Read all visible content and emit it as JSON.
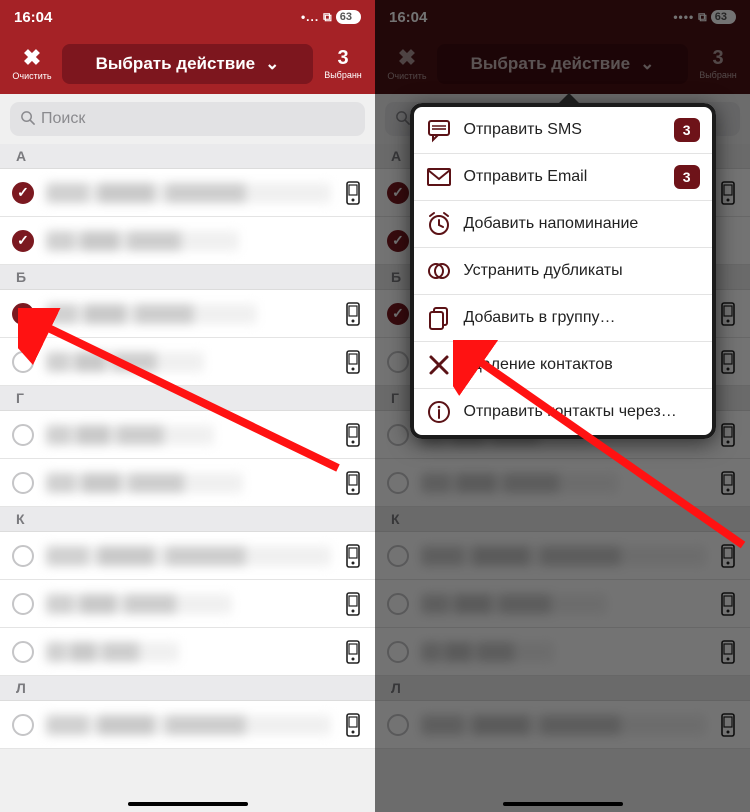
{
  "status": {
    "time": "16:04",
    "battery": "63"
  },
  "toolbar": {
    "clear_label": "Очистить",
    "action_label": "Выбрать действие",
    "selected_count": "3",
    "selected_label": "Выбранн"
  },
  "search": {
    "placeholder": "Поиск"
  },
  "sections": {
    "0": {
      "letter": "А"
    },
    "1": {
      "letter": "Б"
    },
    "2": {
      "letter": "Г"
    },
    "3": {
      "letter": "К"
    },
    "4": {
      "letter": "Л"
    }
  },
  "menu": {
    "items": {
      "0": {
        "label": "Отправить SMS",
        "badge": "3"
      },
      "1": {
        "label": "Отправить Email",
        "badge": "3"
      },
      "2": {
        "label": "Добавить напоминание"
      },
      "3": {
        "label": "Устранить дубликаты"
      },
      "4": {
        "label": "Добавить в группу…"
      },
      "5": {
        "label": "Удаление контактов"
      },
      "6": {
        "label": "Отправить контакты через…"
      }
    }
  }
}
